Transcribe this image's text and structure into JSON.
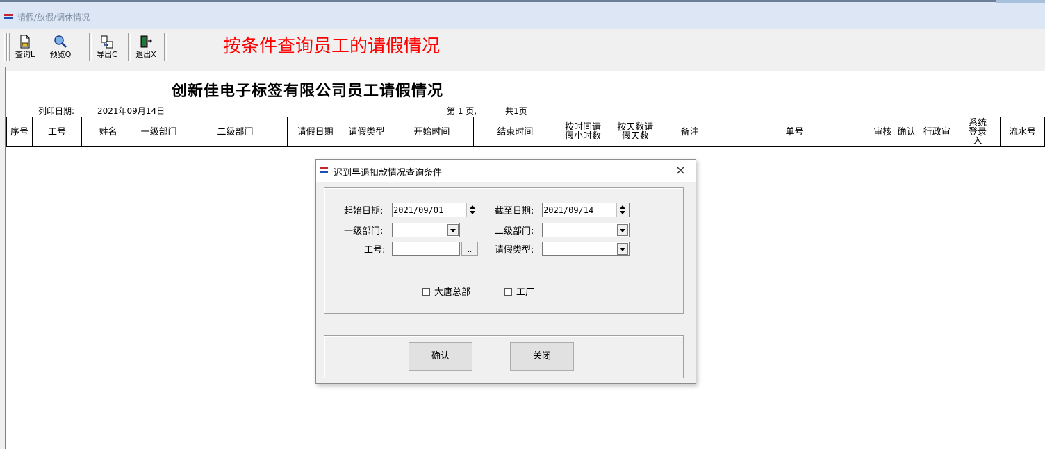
{
  "window": {
    "title": "请假/放假/调休情况"
  },
  "toolbar": {
    "buttons": [
      {
        "label": "查询L",
        "icon": "document-search-icon"
      },
      {
        "label": "预览Q",
        "icon": "magnifier-icon"
      },
      {
        "label": "导出C",
        "icon": "export-icon"
      },
      {
        "label": "退出X",
        "icon": "exit-door-icon"
      }
    ]
  },
  "annotation": "按条件查询员工的请假情况",
  "report": {
    "title": "创新佳电子标签有限公司员工请假情况",
    "print_date_label": "列印日期:",
    "print_date": "2021年09月14日",
    "page_info": "第 1 页,",
    "total_pages": "共1页",
    "columns": [
      "序号",
      "工号",
      "姓名",
      "一级部门",
      "二级部门",
      "请假日期",
      "请假类型",
      "开始时间",
      "结束时间",
      "按时间请假小时数",
      "按天数请假天数",
      "备注",
      "单号",
      "审核",
      "确认",
      "行政审",
      "系统登录入",
      "流水号"
    ]
  },
  "dialog": {
    "title": "迟到早退扣款情况查询条件",
    "close_glyph": "×",
    "start_date_label": "起始日期:",
    "start_date": "2021/09/01",
    "end_date_label": "截至日期:",
    "end_date": "2021/09/14",
    "dept1_label": "一级部门:",
    "dept1_value": "",
    "dept2_label": "二级部门:",
    "dept2_value": "",
    "emp_no_label": "工号:",
    "emp_no_value": "",
    "browse_label": "..",
    "leave_type_label": "请假类型:",
    "leave_type_value": "",
    "check_datang": "大唐总部",
    "check_factory": "工厂",
    "confirm_label": "确认",
    "close_label": "关闭"
  }
}
